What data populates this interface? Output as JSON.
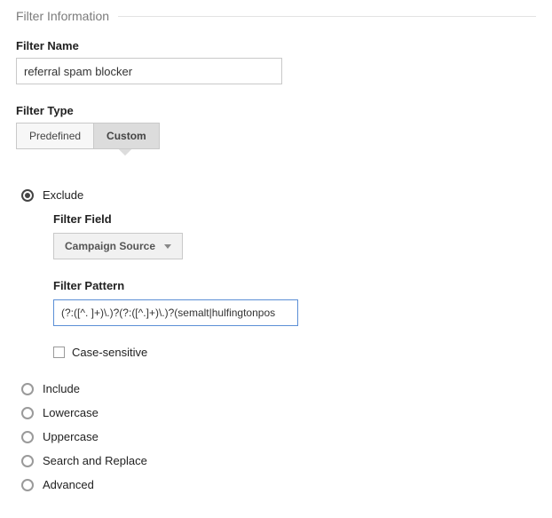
{
  "section_title": "Filter Information",
  "filter_name": {
    "label": "Filter Name",
    "value": "referral spam blocker"
  },
  "filter_type": {
    "label": "Filter Type",
    "tabs": {
      "predefined": "Predefined",
      "custom": "Custom"
    },
    "active_tab": "custom"
  },
  "modes": {
    "exclude": "Exclude",
    "include": "Include",
    "lowercase": "Lowercase",
    "uppercase": "Uppercase",
    "search_replace": "Search and Replace",
    "advanced": "Advanced"
  },
  "exclude": {
    "filter_field_label": "Filter Field",
    "filter_field_value": "Campaign Source",
    "filter_pattern_label": "Filter Pattern",
    "filter_pattern_value": "(?:([^. ]+)\\.)?(?:([^.]+)\\.)?(semalt|hulfingtonpos",
    "case_sensitive_label": "Case-sensitive"
  }
}
